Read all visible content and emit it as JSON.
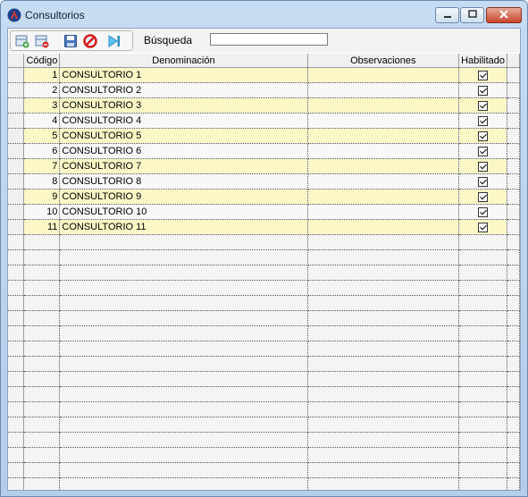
{
  "window": {
    "title": "Consultorios"
  },
  "toolbar": {
    "icons": [
      "add-record-icon",
      "delete-record-icon",
      "save-icon",
      "cancel-icon",
      "next-icon"
    ],
    "search_label": "Búsqueda",
    "search_value": ""
  },
  "grid": {
    "columns": [
      "Código",
      "Denominación",
      "Observaciones",
      "Habilitado"
    ],
    "rows": [
      {
        "code": "1",
        "name": "CONSULTORIO 1",
        "obs": "",
        "enabled": true
      },
      {
        "code": "2",
        "name": "CONSULTORIO 2",
        "obs": "",
        "enabled": true
      },
      {
        "code": "3",
        "name": "CONSULTORIO 3",
        "obs": "",
        "enabled": true
      },
      {
        "code": "4",
        "name": "CONSULTORIO 4",
        "obs": "",
        "enabled": true
      },
      {
        "code": "5",
        "name": "CONSULTORIO 5",
        "obs": "",
        "enabled": true
      },
      {
        "code": "6",
        "name": "CONSULTORIO 6",
        "obs": "",
        "enabled": true
      },
      {
        "code": "7",
        "name": "CONSULTORIO 7",
        "obs": "",
        "enabled": true
      },
      {
        "code": "8",
        "name": "CONSULTORIO 8",
        "obs": "",
        "enabled": true
      },
      {
        "code": "9",
        "name": "CONSULTORIO 9",
        "obs": "",
        "enabled": true
      },
      {
        "code": "10",
        "name": "CONSULTORIO 10",
        "obs": "",
        "enabled": true
      },
      {
        "code": "11",
        "name": "CONSULTORIO 11",
        "obs": "",
        "enabled": true
      }
    ]
  },
  "colors": {
    "odd_row": "#fbf7c6",
    "even_row": "#f8f8f8",
    "title_bar": "#c6dcf2"
  }
}
